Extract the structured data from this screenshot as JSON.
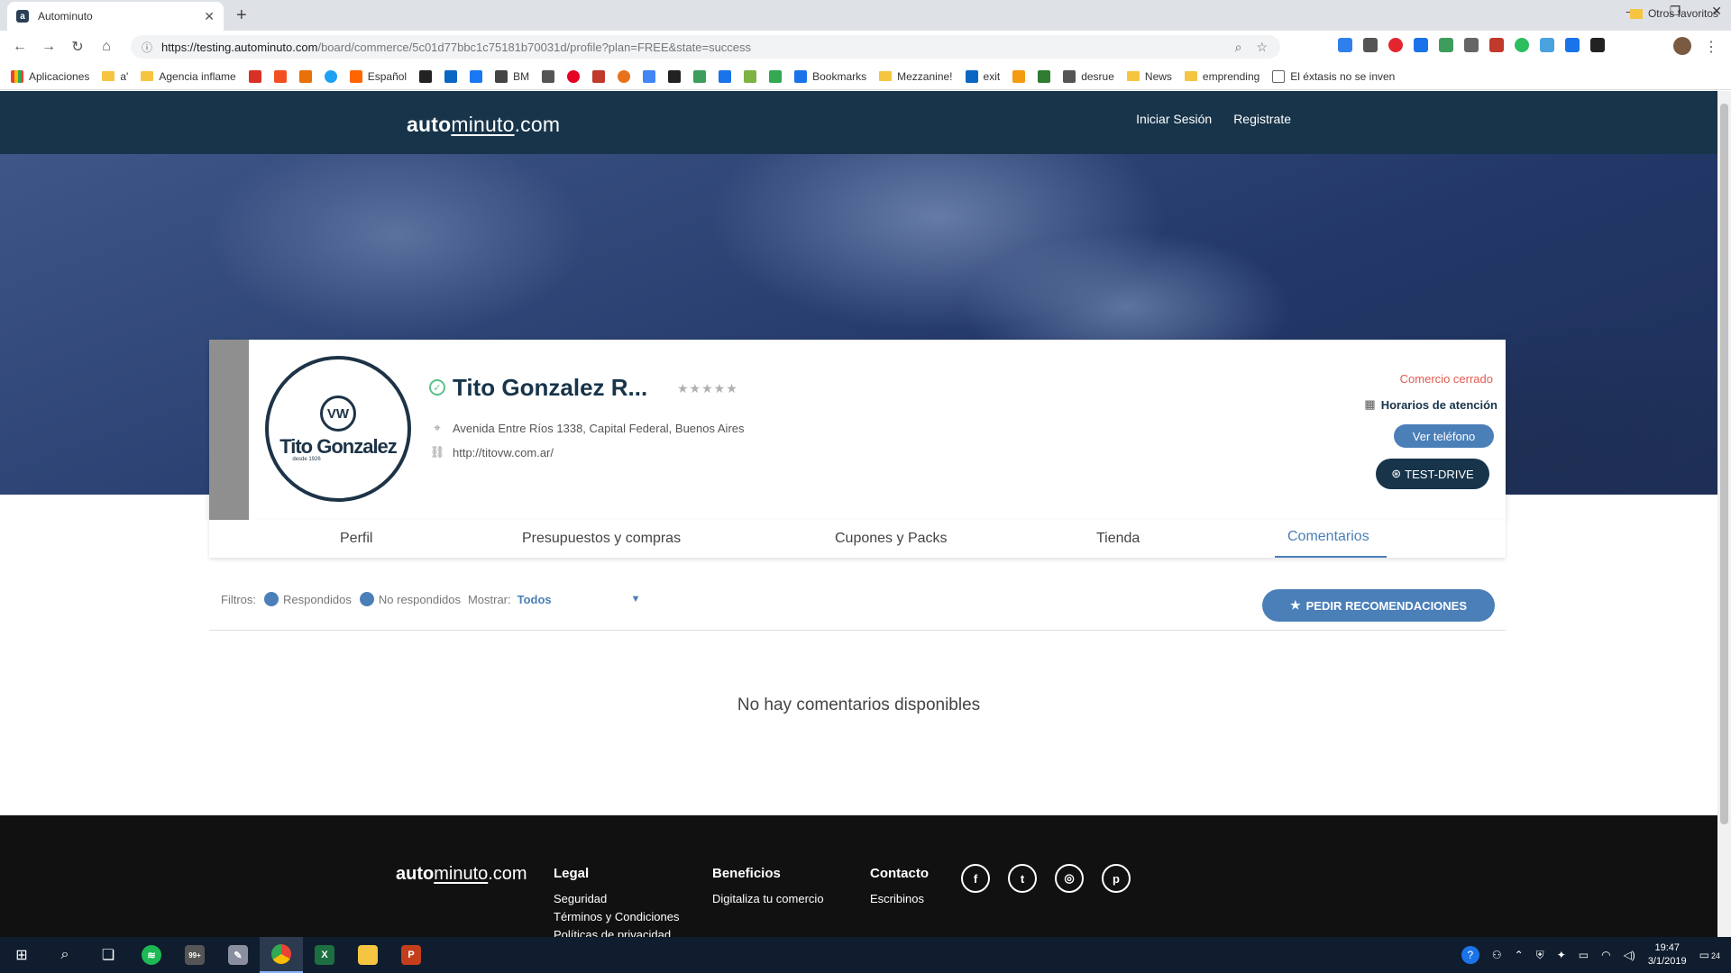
{
  "browser": {
    "tab_title": "Autominuto",
    "url_host": "https://testing.autominuto.com",
    "url_rest": "/board/commerce/5c01d77bbc1c75181b70031d/profile?plan=FREE&state=success",
    "bookmarks": [
      "Aplicaciones",
      "a'",
      "Agencia inflame",
      "Español",
      "BM",
      "Bookmarks",
      "Mezzanine!",
      "exit",
      "desrue",
      "News",
      "emprending",
      "El éxtasis no se inven"
    ],
    "other_bookmarks": "Otros favoritos"
  },
  "site": {
    "logo_bold": "auto",
    "logo_thin": "minuto",
    "logo_suffix": ".com",
    "login": "Iniciar Sesión",
    "register": "Registrate"
  },
  "profile": {
    "brand_logo_text": "Tito Gonzalez",
    "brand_logo_sub": "desde 1926",
    "vw_mark": "VW",
    "name": "Tito Gonzalez R...",
    "stars": "★★★★★",
    "rating": 0,
    "address": "Avenida Entre Ríos 1338, Capital Federal, Buenos Aires",
    "website": "http://titovw.com.ar/",
    "status": "Comercio cerrado",
    "hours_label": "Horarios de atención",
    "phone_button": "Ver teléfono",
    "test_drive_button": "TEST-DRIVE"
  },
  "tabs": [
    "Perfil",
    "Presupuestos y compras",
    "Cupones y Packs",
    "Tienda",
    "Comentarios"
  ],
  "active_tab": "Comentarios",
  "filters": {
    "label": "Filtros:",
    "answered": "Respondidos",
    "unanswered": "No respondidos",
    "show_label": "Mostrar:",
    "show_value": "Todos",
    "request_button": "PEDIR RECOMENDACIONES"
  },
  "empty_message": "No hay comentarios disponibles",
  "footer": {
    "legal_title": "Legal",
    "legal_items": [
      "Seguridad",
      "Términos y Condiciones",
      "Políticas de privacidad"
    ],
    "benefits_title": "Beneficios",
    "benefits_items": [
      "Digitaliza tu comercio"
    ],
    "contact_title": "Contacto",
    "contact_items": [
      "Escribinos"
    ],
    "socials": [
      "facebook-icon",
      "twitter-icon",
      "instagram-icon",
      "pinterest-icon"
    ]
  },
  "taskbar": {
    "time": "19:47",
    "date": "3/1/2019",
    "notifications": "24",
    "mail_badge": "99+"
  },
  "colors": {
    "header": "#17344a",
    "accent": "#4b7fb8",
    "closed": "#e05b4f",
    "footer": "#111111"
  }
}
